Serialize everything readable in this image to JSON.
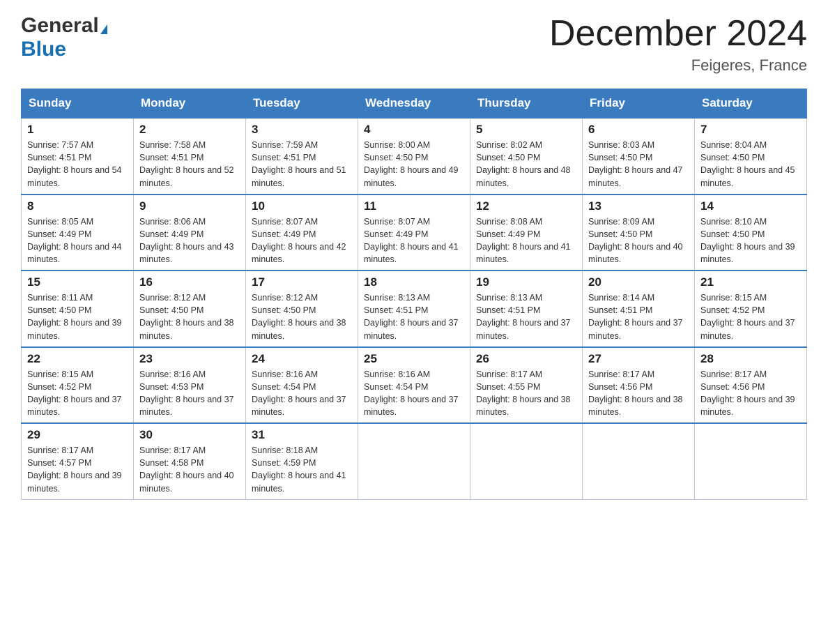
{
  "header": {
    "logo_general": "General",
    "logo_blue": "Blue",
    "month_title": "December 2024",
    "location": "Feigeres, France"
  },
  "days_of_week": [
    "Sunday",
    "Monday",
    "Tuesday",
    "Wednesday",
    "Thursday",
    "Friday",
    "Saturday"
  ],
  "weeks": [
    [
      {
        "day": "1",
        "sunrise": "7:57 AM",
        "sunset": "4:51 PM",
        "daylight": "8 hours and 54 minutes."
      },
      {
        "day": "2",
        "sunrise": "7:58 AM",
        "sunset": "4:51 PM",
        "daylight": "8 hours and 52 minutes."
      },
      {
        "day": "3",
        "sunrise": "7:59 AM",
        "sunset": "4:51 PM",
        "daylight": "8 hours and 51 minutes."
      },
      {
        "day": "4",
        "sunrise": "8:00 AM",
        "sunset": "4:50 PM",
        "daylight": "8 hours and 49 minutes."
      },
      {
        "day": "5",
        "sunrise": "8:02 AM",
        "sunset": "4:50 PM",
        "daylight": "8 hours and 48 minutes."
      },
      {
        "day": "6",
        "sunrise": "8:03 AM",
        "sunset": "4:50 PM",
        "daylight": "8 hours and 47 minutes."
      },
      {
        "day": "7",
        "sunrise": "8:04 AM",
        "sunset": "4:50 PM",
        "daylight": "8 hours and 45 minutes."
      }
    ],
    [
      {
        "day": "8",
        "sunrise": "8:05 AM",
        "sunset": "4:49 PM",
        "daylight": "8 hours and 44 minutes."
      },
      {
        "day": "9",
        "sunrise": "8:06 AM",
        "sunset": "4:49 PM",
        "daylight": "8 hours and 43 minutes."
      },
      {
        "day": "10",
        "sunrise": "8:07 AM",
        "sunset": "4:49 PM",
        "daylight": "8 hours and 42 minutes."
      },
      {
        "day": "11",
        "sunrise": "8:07 AM",
        "sunset": "4:49 PM",
        "daylight": "8 hours and 41 minutes."
      },
      {
        "day": "12",
        "sunrise": "8:08 AM",
        "sunset": "4:49 PM",
        "daylight": "8 hours and 41 minutes."
      },
      {
        "day": "13",
        "sunrise": "8:09 AM",
        "sunset": "4:50 PM",
        "daylight": "8 hours and 40 minutes."
      },
      {
        "day": "14",
        "sunrise": "8:10 AM",
        "sunset": "4:50 PM",
        "daylight": "8 hours and 39 minutes."
      }
    ],
    [
      {
        "day": "15",
        "sunrise": "8:11 AM",
        "sunset": "4:50 PM",
        "daylight": "8 hours and 39 minutes."
      },
      {
        "day": "16",
        "sunrise": "8:12 AM",
        "sunset": "4:50 PM",
        "daylight": "8 hours and 38 minutes."
      },
      {
        "day": "17",
        "sunrise": "8:12 AM",
        "sunset": "4:50 PM",
        "daylight": "8 hours and 38 minutes."
      },
      {
        "day": "18",
        "sunrise": "8:13 AM",
        "sunset": "4:51 PM",
        "daylight": "8 hours and 37 minutes."
      },
      {
        "day": "19",
        "sunrise": "8:13 AM",
        "sunset": "4:51 PM",
        "daylight": "8 hours and 37 minutes."
      },
      {
        "day": "20",
        "sunrise": "8:14 AM",
        "sunset": "4:51 PM",
        "daylight": "8 hours and 37 minutes."
      },
      {
        "day": "21",
        "sunrise": "8:15 AM",
        "sunset": "4:52 PM",
        "daylight": "8 hours and 37 minutes."
      }
    ],
    [
      {
        "day": "22",
        "sunrise": "8:15 AM",
        "sunset": "4:52 PM",
        "daylight": "8 hours and 37 minutes."
      },
      {
        "day": "23",
        "sunrise": "8:16 AM",
        "sunset": "4:53 PM",
        "daylight": "8 hours and 37 minutes."
      },
      {
        "day": "24",
        "sunrise": "8:16 AM",
        "sunset": "4:54 PM",
        "daylight": "8 hours and 37 minutes."
      },
      {
        "day": "25",
        "sunrise": "8:16 AM",
        "sunset": "4:54 PM",
        "daylight": "8 hours and 37 minutes."
      },
      {
        "day": "26",
        "sunrise": "8:17 AM",
        "sunset": "4:55 PM",
        "daylight": "8 hours and 38 minutes."
      },
      {
        "day": "27",
        "sunrise": "8:17 AM",
        "sunset": "4:56 PM",
        "daylight": "8 hours and 38 minutes."
      },
      {
        "day": "28",
        "sunrise": "8:17 AM",
        "sunset": "4:56 PM",
        "daylight": "8 hours and 39 minutes."
      }
    ],
    [
      {
        "day": "29",
        "sunrise": "8:17 AM",
        "sunset": "4:57 PM",
        "daylight": "8 hours and 39 minutes."
      },
      {
        "day": "30",
        "sunrise": "8:17 AM",
        "sunset": "4:58 PM",
        "daylight": "8 hours and 40 minutes."
      },
      {
        "day": "31",
        "sunrise": "8:18 AM",
        "sunset": "4:59 PM",
        "daylight": "8 hours and 41 minutes."
      },
      null,
      null,
      null,
      null
    ]
  ]
}
